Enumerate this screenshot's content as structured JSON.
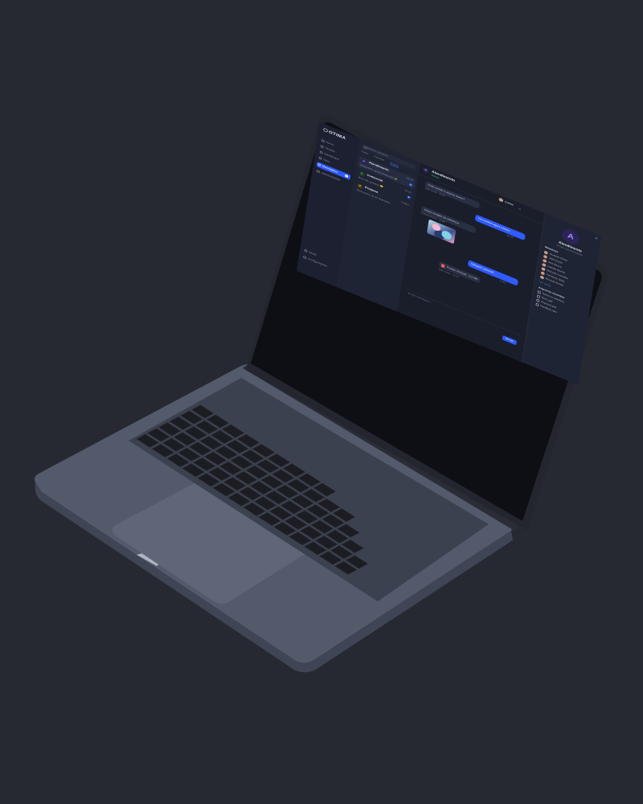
{
  "colors": {
    "background": "#262932",
    "accent": "#2f5bff",
    "online": "#2ecc71",
    "laptop_body": "#4f5566",
    "keys": "#1b1d22"
  },
  "app": {
    "logo": "OTIMA"
  },
  "nav": {
    "items": [
      {
        "label": "Home",
        "icon": "home-icon"
      },
      {
        "label": "Tarefas",
        "icon": "tasks-icon"
      },
      {
        "label": "Dashboard",
        "icon": "dashboard-icon"
      },
      {
        "label": "Sites",
        "icon": "sites-icon"
      },
      {
        "label": "Mensagens",
        "icon": "chat-icon",
        "badge": "3"
      },
      {
        "label": "Administração",
        "icon": "admin-icon"
      }
    ],
    "bottom": [
      {
        "label": "Ajuda",
        "icon": "help-icon"
      },
      {
        "label": "Configurações",
        "icon": "gear-icon"
      }
    ]
  },
  "chat_list": {
    "search_placeholder": "Buscar conversa",
    "filters": [
      "Todos",
      "Pessoas",
      "Grupos"
    ],
    "active_filter": "Grupos",
    "items": [
      {
        "letter": "A",
        "name": "Atendimento",
        "time": "14:20",
        "preview": "Entendido, ajuste finalizado ✨",
        "badge": "2"
      },
      {
        "letter": "C",
        "name": "Comercial",
        "time": "13:15",
        "preview": "Bom dia, pessoal 😊",
        "badge": "5"
      },
      {
        "letter": "P",
        "name": "Projetos",
        "time": "Ontem",
        "preview": "Novo prazo de 30 dias para...",
        "badge": ""
      }
    ]
  },
  "conversation": {
    "title": "Atendimento",
    "subtitle": "Online",
    "messages": [
      {
        "from": "Julia Costa",
        "text": "Pode revisar o arquivo anexo?",
        "time": "10:30"
      },
      {
        "from": "me",
        "text": "Vou conferir agora mesmo",
        "time": "10:45"
      },
      {
        "from": "Gustavo Rossi",
        "text": "Segue imagem da referência",
        "time": "11:00"
      },
      {
        "from": "me",
        "text": "Obrigado, pessoal!",
        "time": "11:12"
      },
      {
        "from": "Julia Costa",
        "file": "Projeto_final.pdf",
        "size": "2,3 MB",
        "time": "11:20"
      }
    ],
    "image_caption": "Gustavo Rossi",
    "composer_placeholder": "Enviar mensagem...",
    "send_label": "Enviar",
    "member_count": "+8"
  },
  "info_panel": {
    "letter": "A",
    "title": "Atendimento",
    "subtitle": "Grupo Comunicações",
    "members_label": "Membros",
    "members": [
      "Gustavo Rossi",
      "Julia Costa",
      "Ana Souza",
      "Larissa Rocha",
      "Marcelo Carvalho",
      "Fernando Silva",
      "Ricardo Nunes"
    ],
    "see_all": "Ver todos",
    "files_label": "Arquivos recentes",
    "files": [
      "Todos os arquivos",
      "Doc1.pdf",
      "Arquivo2.pdf",
      "Planilha3.xlsx"
    ],
    "user": "Carlos"
  }
}
